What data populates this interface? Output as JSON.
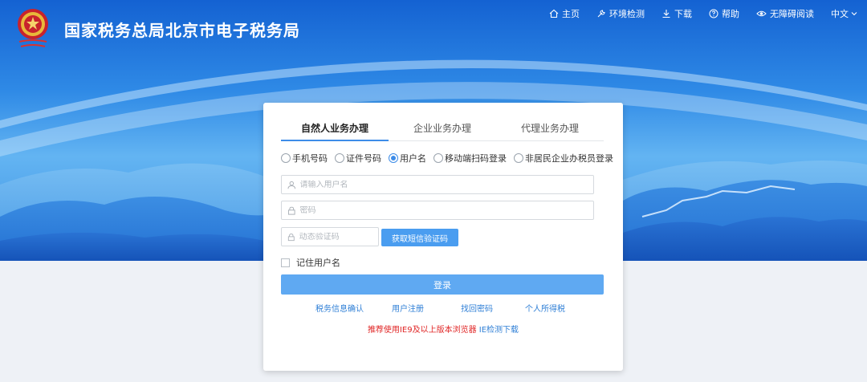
{
  "header": {
    "site_title": "国家税务总局北京市电子税务局",
    "nav": {
      "home": "主页",
      "env_check": "环境检测",
      "download": "下载",
      "help": "帮助",
      "accessibility": "无障碍阅读",
      "language": "中文"
    }
  },
  "login": {
    "tabs": [
      "自然人业务办理",
      "企业业务办理",
      "代理业务办理"
    ],
    "login_types": [
      "手机号码",
      "证件号码",
      "用户名",
      "移动端扫码登录",
      "非居民企业办税员登录"
    ],
    "username_placeholder": "请输入用户名",
    "password_placeholder": "密码",
    "code_placeholder": "动态验证码",
    "sms_button": "获取短信验证码",
    "remember_label": "记住用户名",
    "login_button": "登录",
    "links": [
      "税务信息确认",
      "用户注册",
      "找回密码",
      "个人所得税"
    ],
    "browser_notice": "推荐使用IE9及以上版本浏览器",
    "ie_link": "IE检测下载"
  },
  "colors": {
    "primary": "#3d8ce8",
    "button": "#5fa9f2",
    "link": "#2f7fd6",
    "notice_red": "#e02424"
  }
}
